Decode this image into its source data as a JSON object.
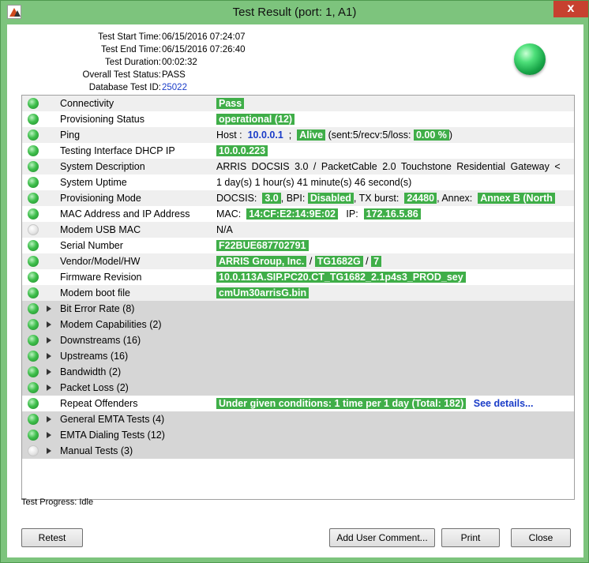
{
  "window": {
    "title": "Test Result (port: 1, A1)",
    "close_glyph": "x"
  },
  "summary": [
    {
      "label": "Test Start Time:",
      "value": "06/15/2016 07:24:07"
    },
    {
      "label": "Test End Time:",
      "value": "06/15/2016 07:26:40"
    },
    {
      "label": "Test Duration:",
      "value": "00:02:32"
    },
    {
      "label": "Overall Test Status:",
      "value": "PASS"
    },
    {
      "label": "Database Test ID:",
      "value": "25022"
    }
  ],
  "overall_status_color": "#2fbf5a",
  "rows": {
    "connectivity": {
      "label": "Connectivity",
      "value": "Pass"
    },
    "provisioning_status": {
      "label": "Provisioning Status",
      "value": "operational (12)"
    },
    "ping": {
      "label": "Ping",
      "host_label": "Host :",
      "host": "10.0.0.1",
      "sep": ";",
      "state": "Alive",
      "stats_pre": "(sent:5/recv:5/loss:",
      "loss": "0.00 %",
      "stats_post": ")"
    },
    "dhcp_ip": {
      "label": "Testing Interface DHCP IP",
      "value": "10.0.0.223"
    },
    "system_description": {
      "label": "System Description",
      "value": "ARRIS DOCSIS 3.0 / PacketCable 2.0 Touchstone Residential Gateway <"
    },
    "system_uptime": {
      "label": "System Uptime",
      "value": "1 day(s) 1 hour(s) 41 minute(s) 46 second(s)"
    },
    "provisioning_mode": {
      "label": "Provisioning Mode",
      "docsis_label": "DOCSIS:",
      "docsis": "3.0",
      "bpi_label": ", BPI:",
      "bpi": "Disabled",
      "burst_label": ", TX burst:",
      "burst": "24480",
      "annex_label": ", Annex:",
      "annex": "Annex B (North"
    },
    "mac_ip": {
      "label": "MAC Address and IP Address",
      "mac_label": "MAC:",
      "mac": "14:CF:E2:14:9E:02",
      "ip_label": "IP:",
      "ip": "172.16.5.86"
    },
    "usb_mac": {
      "label": "Modem USB MAC",
      "value": "N/A"
    },
    "serial": {
      "label": "Serial Number",
      "value": "F22BUE687702791"
    },
    "vendor": {
      "label": "Vendor/Model/HW",
      "vendor": "ARRIS Group, Inc.",
      "sep1": "/",
      "model": "TG1682G",
      "sep2": "/",
      "hw": "7"
    },
    "firmware": {
      "label": "Firmware Revision",
      "value": "10.0.113A.SIP.PC20.CT_TG1682_2.1p4s3_PROD_sey"
    },
    "boot_file": {
      "label": "Modem boot file",
      "value": "cmUm30arrisG.bin"
    },
    "bit_error_rate": {
      "label": "Bit Error Rate (8)"
    },
    "modem_capabilities": {
      "label": "Modem Capabilities (2)"
    },
    "downstreams": {
      "label": "Downstreams (16)"
    },
    "upstreams": {
      "label": "Upstreams (16)"
    },
    "bandwidth": {
      "label": "Bandwidth (2)"
    },
    "packet_loss": {
      "label": "Packet Loss (2)"
    },
    "repeat_offenders": {
      "label": "Repeat Offenders",
      "value": "Under given conditions: 1 time per 1 day (Total: 182)",
      "link": "See details..."
    },
    "general_emta": {
      "label": "General EMTA Tests (4)"
    },
    "emta_dialing": {
      "label": "EMTA Dialing Tests (12)"
    },
    "manual_tests": {
      "label": "Manual Tests (3)"
    }
  },
  "progress": "Test Progress: Idle",
  "buttons": {
    "retest": "Retest",
    "add_comment": "Add User Comment...",
    "print": "Print",
    "close": "Close"
  }
}
